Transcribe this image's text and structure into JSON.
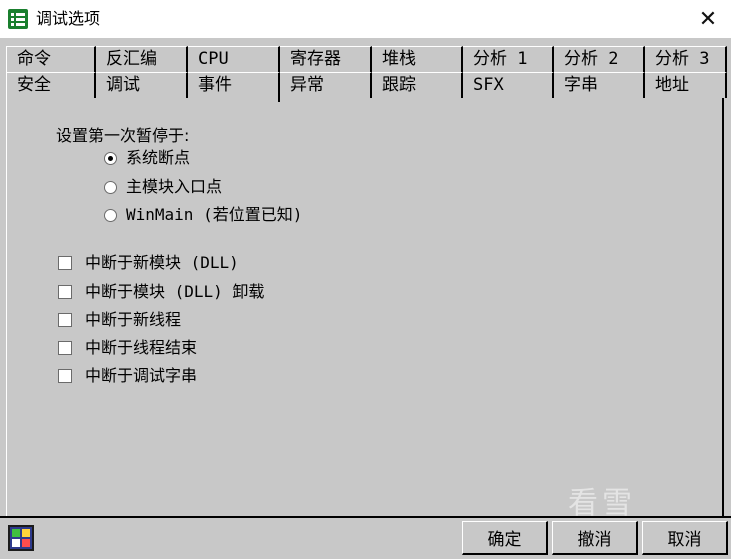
{
  "window": {
    "title": "调试选项",
    "close_glyph": "✕"
  },
  "tabs": {
    "back_row": [
      "命令",
      "反汇编",
      "CPU",
      "寄存器",
      "堆栈",
      "分析 1",
      "分析 2",
      "分析 3"
    ],
    "front_row": [
      "安全",
      "调试",
      "事件",
      "异常",
      "跟踪",
      "SFX",
      "字串",
      "地址"
    ],
    "active": "事件"
  },
  "first_pause": {
    "label": "设置第一次暂停于:",
    "options": [
      {
        "label": "系统断点",
        "checked": true
      },
      {
        "label": "主模块入口点",
        "checked": false
      },
      {
        "label": "WinMain (若位置已知)",
        "checked": false
      }
    ]
  },
  "checkboxes": [
    {
      "label": "中断于新模块 (DLL)",
      "checked": false
    },
    {
      "label": "中断于模块 (DLL) 卸载",
      "checked": false
    },
    {
      "label": "中断于新线程",
      "checked": false
    },
    {
      "label": "中断于线程结束",
      "checked": false
    },
    {
      "label": "中断于调试字串",
      "checked": false
    }
  ],
  "watermark": "看雪",
  "buttons": {
    "ok": "确定",
    "undo": "撤消",
    "cancel": "取消"
  },
  "icons": {
    "app": "list-icon",
    "bottom": "grid-icon",
    "close": "close-icon"
  },
  "colors": {
    "face": "#c8c8c8",
    "titlebar": "#ffffff",
    "app_icon": "#1a7f2e"
  }
}
